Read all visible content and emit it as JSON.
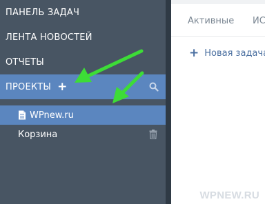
{
  "sidebar": {
    "items": [
      {
        "label": "ПАНЕЛЬ ЗАДАЧ"
      },
      {
        "label": "ЛЕНТА НОВОСТЕЙ"
      },
      {
        "label": "ОТЧЕТЫ"
      },
      {
        "label": "ПРОЕКТЫ",
        "add_glyph": "+"
      }
    ],
    "projects": [
      {
        "label": "WPnew.ru",
        "icon": "document-icon",
        "selected": true
      },
      {
        "label": "Корзина",
        "icon": "trash-icon",
        "selected": false
      }
    ]
  },
  "main": {
    "tabs": [
      {
        "label": "Активные"
      },
      {
        "label": "ИС"
      }
    ],
    "new_task": {
      "glyph": "+",
      "label": "Новая задача"
    }
  },
  "watermark": "WPNEW.RU",
  "colors": {
    "sidebar_bg": "#485563",
    "selected_bg": "#5b86bf",
    "arrow": "#3ddc37",
    "link": "#4a6fa0"
  }
}
